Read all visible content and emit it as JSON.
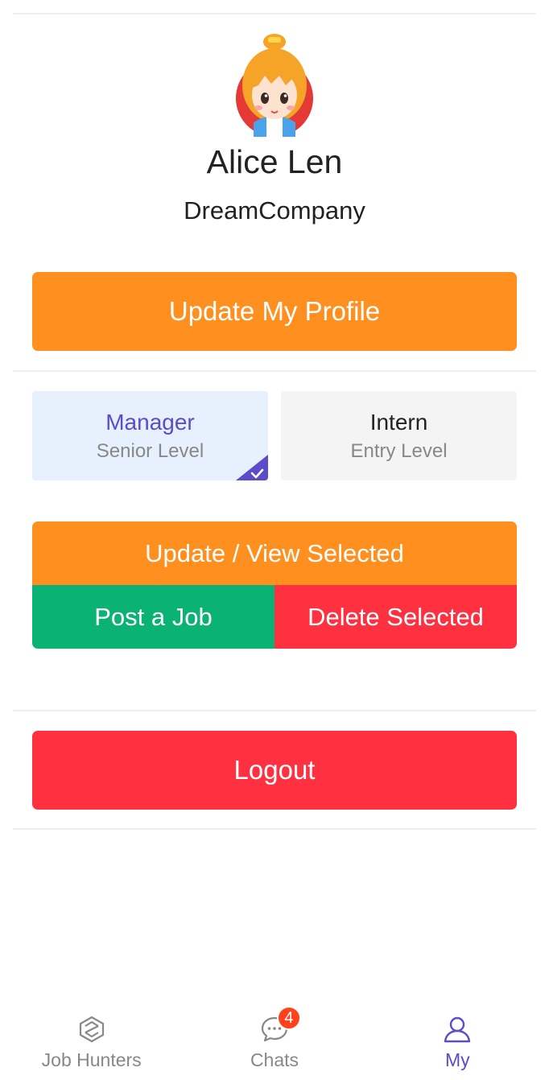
{
  "profile": {
    "name": "Alice Len",
    "company": "DreamCompany",
    "update_profile_label": "Update My Profile"
  },
  "jobs": [
    {
      "title": "Manager",
      "level": "Senior Level",
      "selected": true
    },
    {
      "title": "Intern",
      "level": "Entry Level",
      "selected": false
    }
  ],
  "actions": {
    "update_view_label": "Update / View Selected",
    "post_job_label": "Post a Job",
    "delete_label": "Delete Selected",
    "logout_label": "Logout"
  },
  "tabbar": {
    "items": [
      {
        "label": "Job Hunters",
        "icon": "job-hunters-icon",
        "active": false
      },
      {
        "label": "Chats",
        "icon": "chat-bubble-icon",
        "active": false,
        "badge": "4"
      },
      {
        "label": "My",
        "icon": "user-icon",
        "active": true
      }
    ]
  },
  "colors": {
    "accent": "#5b4ccc",
    "orange": "#ff8f1f",
    "green": "#0ab373",
    "red": "#ff3141",
    "selected_bg": "#e6f1fd"
  }
}
